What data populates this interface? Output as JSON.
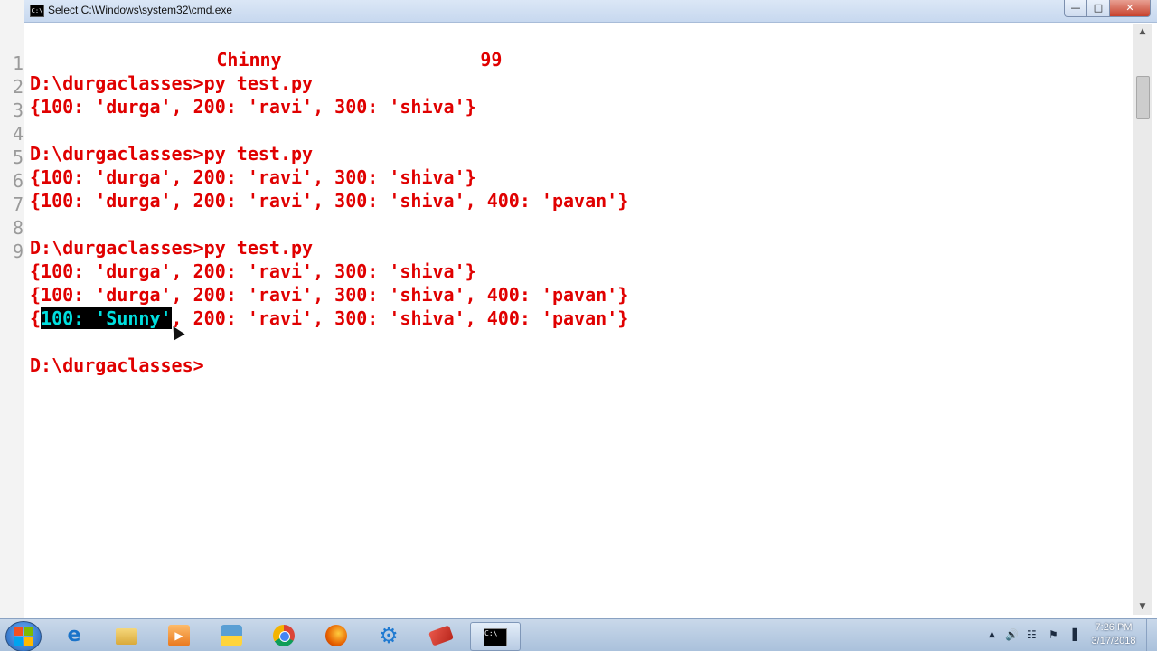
{
  "window": {
    "title": "Select C:\\Windows\\system32\\cmd.exe",
    "icon_label": "C:\\",
    "min_glyph": "—",
    "max_glyph": "□",
    "close_glyph": "✕"
  },
  "gutter": [
    "1",
    "2",
    "3",
    "4",
    "5",
    "6",
    "7",
    "8",
    "9"
  ],
  "console": {
    "partial_line_name": "Chinny",
    "partial_line_value": "99",
    "lines": [
      "D:\\durgaclasses>py test.py",
      "{100: 'durga', 200: 'ravi', 300: 'shiva'}",
      "",
      "D:\\durgaclasses>py test.py",
      "{100: 'durga', 200: 'ravi', 300: 'shiva'}",
      "{100: 'durga', 200: 'ravi', 300: 'shiva', 400: 'pavan'}",
      "",
      "D:\\durgaclasses>py test.py",
      "{100: 'durga', 200: 'ravi', 300: 'shiva'}",
      "{100: 'durga', 200: 'ravi', 300: 'shiva', 400: 'pavan'}"
    ],
    "selected_line": {
      "before": "{",
      "selected": "100: 'Sunny'",
      "after": ", 200: 'ravi', 300: 'shiva', 400: 'pavan'}"
    },
    "prompt": "D:\\durgaclasses>"
  },
  "taskbar": {
    "items": [
      {
        "name": "internet-explorer-icon",
        "glyph": "e"
      },
      {
        "name": "file-explorer-icon",
        "glyph": ""
      },
      {
        "name": "media-player-icon",
        "glyph": "▶"
      },
      {
        "name": "python-file-icon",
        "glyph": ""
      },
      {
        "name": "chrome-icon",
        "glyph": ""
      },
      {
        "name": "firefox-icon",
        "glyph": ""
      },
      {
        "name": "settings-gear-icon",
        "glyph": "⚙"
      },
      {
        "name": "eraser-icon",
        "glyph": ""
      },
      {
        "name": "cmd-icon",
        "glyph": "C:\\_"
      }
    ],
    "active_item": "cmd-icon",
    "tray": {
      "up_arrow": "▲",
      "volume": "🔊",
      "network": "☷",
      "signal": "▐"
    },
    "clock": {
      "time": "7:26 PM",
      "date": "3/17/2018"
    }
  }
}
